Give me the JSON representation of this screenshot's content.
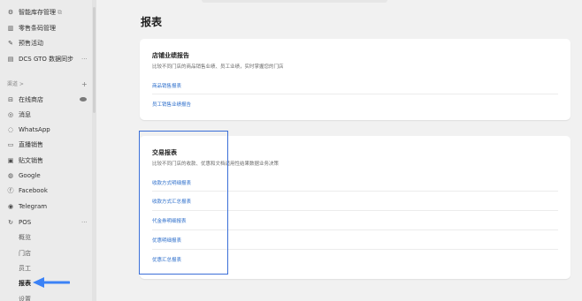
{
  "sidebar": {
    "top_items": [
      {
        "label": "智能库存管理",
        "icon": "inventory-icon",
        "external": true
      },
      {
        "label": "零售条码管理",
        "icon": "barcode-icon"
      },
      {
        "label": "预售活动",
        "icon": "presale-icon"
      },
      {
        "label": "DCS GTO 数据同步",
        "icon": "sync-icon",
        "trail": "···"
      }
    ],
    "channels_header": "渠道 >",
    "channels": [
      {
        "label": "在线商店",
        "icon": "store-icon",
        "eye": true
      },
      {
        "label": "消息",
        "icon": "message-icon"
      },
      {
        "label": "WhatsApp",
        "icon": "whatsapp-icon"
      },
      {
        "label": "直播销售",
        "icon": "live-icon"
      },
      {
        "label": "贴文销售",
        "icon": "post-icon"
      },
      {
        "label": "Google",
        "icon": "google-icon"
      },
      {
        "label": "Facebook",
        "icon": "facebook-icon"
      },
      {
        "label": "Telegram",
        "icon": "telegram-icon"
      },
      {
        "label": "POS",
        "icon": "pos-icon",
        "trail": "···"
      }
    ],
    "pos_sub": [
      "概览",
      "门店",
      "员工",
      "报表",
      "设置"
    ],
    "active_sub": "报表"
  },
  "main": {
    "title": "报表",
    "store_card": {
      "title": "店铺业绩报告",
      "desc": "比较不同门店的商品销售业绩、员工业绩，实时掌握您的门店",
      "links": [
        "商品销售报表",
        "员工销售业绩报告"
      ]
    },
    "txn_card": {
      "title": "交易报表",
      "desc": "比较不同门店的收款、优惠和文档适用性结果数据业务决策",
      "links": [
        "收款方式明细报表",
        "收款方式汇总报表",
        "代金券明细报表",
        "优惠明细报表",
        "优惠汇总报表"
      ]
    }
  },
  "colors": {
    "accent_link": "#2c6ecb",
    "highlight_border": "#3b6fd8",
    "annotation_arrow": "#3b82f6"
  }
}
